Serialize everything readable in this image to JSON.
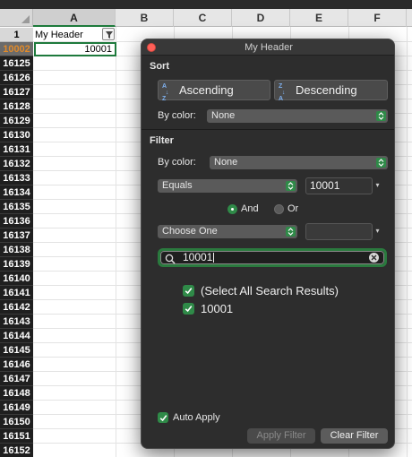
{
  "sheet": {
    "columns": [
      "A",
      "B",
      "C",
      "D",
      "E",
      "F"
    ],
    "header_row_number": "1",
    "selected_row_number": "10002",
    "row_numbers": [
      "16125",
      "16126",
      "16127",
      "16128",
      "16129",
      "16130",
      "16131",
      "16132",
      "16133",
      "16134",
      "16135",
      "16136",
      "16137",
      "16138",
      "16139",
      "16140",
      "16141",
      "16142",
      "16143",
      "16144",
      "16145",
      "16146",
      "16147",
      "16148",
      "16149",
      "16150",
      "16151",
      "16152"
    ],
    "cell_a1": "My Header",
    "cell_a2": "10001"
  },
  "popover": {
    "title": "My Header",
    "sort": {
      "heading": "Sort",
      "ascending_label": "Ascending",
      "descending_label": "Descending",
      "by_color_label": "By color:",
      "by_color_value": "None"
    },
    "filter": {
      "heading": "Filter",
      "by_color_label": "By color:",
      "by_color_value": "None",
      "condition1_operator": "Equals",
      "condition1_value": "10001",
      "and_label": "And",
      "or_label": "Or",
      "condition2_operator": "Choose One",
      "condition2_value": "",
      "search_value": "10001",
      "list_items": [
        {
          "label": "(Select All Search Results)",
          "checked": true
        },
        {
          "label": "10001",
          "checked": true
        }
      ]
    },
    "auto_apply_label": "Auto Apply",
    "apply_filter_label": "Apply Filter",
    "clear_filter_label": "Clear Filter"
  },
  "icons": {
    "filter": "funnel-icon",
    "search": "magnifier-icon",
    "clear": "clear-circle-icon",
    "stepper": "up-down-chevron-icon",
    "check": "checkmark-icon"
  },
  "colors": {
    "accent_green": "#2f8a48",
    "selection_border": "#1e7a3c",
    "popover_bg": "#2d2d2d",
    "selected_row_text": "#e08a2a"
  }
}
